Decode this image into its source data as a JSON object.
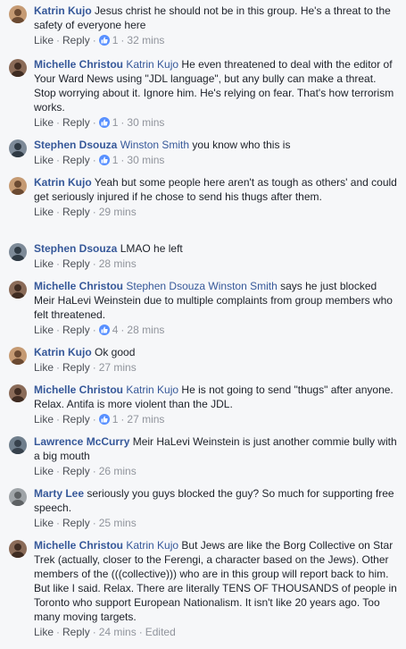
{
  "comments": [
    {
      "author": "Katrin Kujo",
      "mentions": "",
      "text": "Jesus christ he should not be in this group. He's a threat to the safety of everyone here",
      "like": "Like",
      "reply": "Reply",
      "likes": "1",
      "time": "32 mins",
      "edited": ""
    },
    {
      "author": "Michelle Christou",
      "mentions": "Katrin Kujo",
      "text": "He even threatened to deal with the editor of Your Ward News using \"JDL language\", but any bully can make a threat. Stop worrying about it. Ignore him. He's relying on fear. That's how terrorism works.",
      "like": "Like",
      "reply": "Reply",
      "likes": "1",
      "time": "30 mins",
      "edited": ""
    },
    {
      "author": "Stephen Dsouza",
      "mentions": "Winston Smith",
      "text": "you know who this is",
      "like": "Like",
      "reply": "Reply",
      "likes": "1",
      "time": "30 mins",
      "edited": ""
    },
    {
      "author": "Katrin Kujo",
      "mentions": "",
      "text": "Yeah but some people here aren't as tough as others' and could get seriously injured if he chose to send his thugs after them.",
      "like": "Like",
      "reply": "Reply",
      "likes": "",
      "time": "29 mins",
      "edited": ""
    },
    {
      "author": "Stephen Dsouza",
      "mentions": "",
      "text": "LMAO he left",
      "like": "Like",
      "reply": "Reply",
      "likes": "",
      "time": "28 mins",
      "edited": ""
    },
    {
      "author": "Michelle Christou",
      "mentions": "Stephen Dsouza Winston Smith",
      "text": "says he just blocked Meir HaLevi Weinstein due to multiple complaints from group members who felt threatened.",
      "like": "Like",
      "reply": "Reply",
      "likes": "4",
      "time": "28 mins",
      "edited": ""
    },
    {
      "author": "Katrin Kujo",
      "mentions": "",
      "text": "Ok good",
      "like": "Like",
      "reply": "Reply",
      "likes": "",
      "time": "27 mins",
      "edited": ""
    },
    {
      "author": "Michelle Christou",
      "mentions": "Katrin Kujo",
      "text": "He is not going to send \"thugs\" after anyone. Relax. Antifa is more violent than the JDL.",
      "like": "Like",
      "reply": "Reply",
      "likes": "1",
      "time": "27 mins",
      "edited": ""
    },
    {
      "author": "Lawrence McCurry",
      "mentions": "",
      "text": "Meir HaLevi Weinstein is just another commie bully with a big mouth",
      "like": "Like",
      "reply": "Reply",
      "likes": "",
      "time": "26 mins",
      "edited": ""
    },
    {
      "author": "Marty Lee",
      "mentions": "",
      "text": "seriously you guys blocked the guy? So much for supporting free speech.",
      "like": "Like",
      "reply": "Reply",
      "likes": "",
      "time": "25 mins",
      "edited": ""
    },
    {
      "author": "Michelle Christou",
      "mentions": "Katrin Kujo",
      "text": "But Jews are like the Borg Collective on Star Trek (actually, closer to the Ferengi, a character based on the Jews). Other members of the (((collective))) who are in this group will report back to him. But like I said. Relax. There are literally TENS OF THOUSANDS of people in Toronto who support European Nationalism. It isn't like 20 years ago. Too many moving targets.",
      "like": "Like",
      "reply": "Reply",
      "likes": "",
      "time": "24 mins",
      "edited": "Edited"
    }
  ],
  "colors": {
    "background": "#f6f7f9",
    "author": "#365899",
    "like_badge": "#5890ff",
    "meta": "#90949c"
  },
  "icons": [
    "avatar",
    "like-reaction-icon"
  ]
}
